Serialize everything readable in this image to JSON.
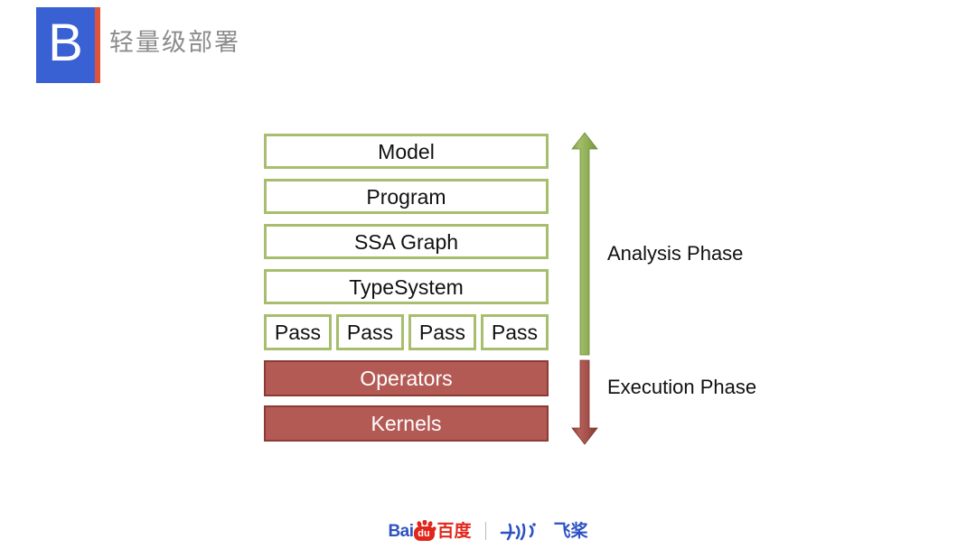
{
  "header": {
    "brand_letter": "B",
    "title": "轻量级部署",
    "accent_color": "#E0533A",
    "brand_color": "#3961D3",
    "title_color": "#8C8C8C"
  },
  "diagram": {
    "analysis_layers": [
      {
        "label": "Model"
      },
      {
        "label": "Program"
      },
      {
        "label": "SSA Graph"
      },
      {
        "label": "TypeSystem"
      }
    ],
    "pass_boxes": [
      {
        "label": "Pass"
      },
      {
        "label": "Pass"
      },
      {
        "label": "Pass"
      },
      {
        "label": "Pass"
      }
    ],
    "execution_layers": [
      {
        "label": "Operators"
      },
      {
        "label": "Kernels"
      }
    ],
    "phases": [
      {
        "label": "Analysis Phase",
        "direction": "up",
        "color": "#8EAE55"
      },
      {
        "label": "Execution Phase",
        "direction": "down",
        "color": "#A64F48"
      }
    ],
    "colors": {
      "analysis_border": "#A7BE6E",
      "analysis_fill": "#FFFFFF",
      "execution_fill": "#B45A55",
      "execution_border": "#8B3A34",
      "execution_text": "#FFFFFF",
      "analysis_text": "#111111"
    }
  },
  "footer": {
    "baidu_latin": "Bai",
    "baidu_du": "du",
    "baidu_hanzi": "百度",
    "paddle_hanzi": "飞桨",
    "baidu_blue": "#2D51C4",
    "baidu_red": "#E1261C"
  }
}
